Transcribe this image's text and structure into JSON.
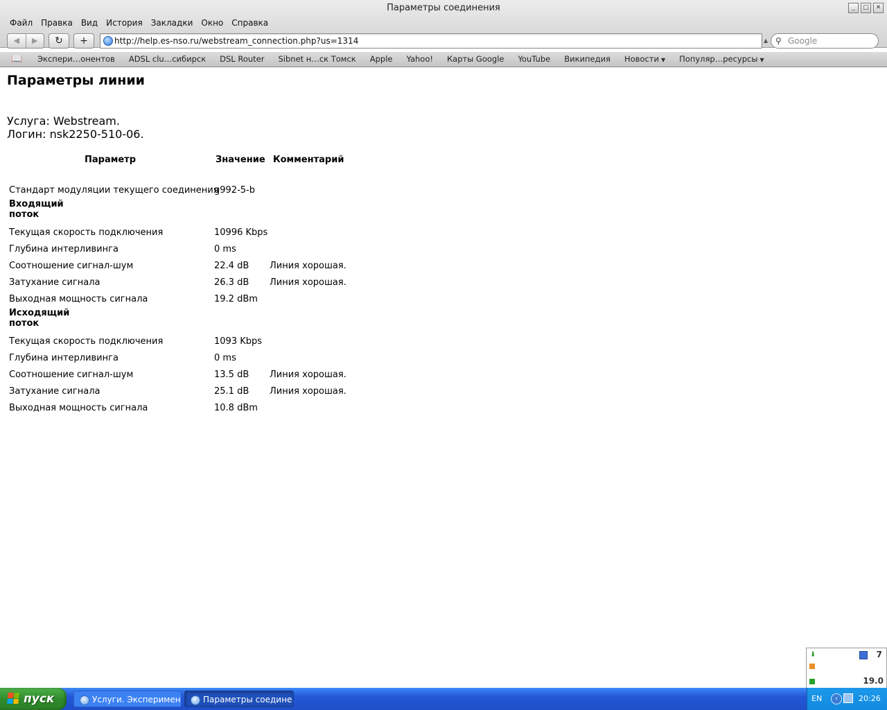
{
  "window": {
    "title": "Параметры соединения",
    "controls": {
      "minimize": "_",
      "maximize": "□",
      "close": "✕"
    }
  },
  "menu": [
    "Файл",
    "Правка",
    "Вид",
    "История",
    "Закладки",
    "Окно",
    "Справка"
  ],
  "toolbar": {
    "back": "◀",
    "forward": "▶",
    "reload": "↻",
    "add": "+",
    "url": "http://help.es-nso.ru/webstream_connection.php?us=1314",
    "search_placeholder": "Google"
  },
  "bookmarks": [
    {
      "label": "Экспери…онентов",
      "menu": false
    },
    {
      "label": "ADSL clu…сибирск",
      "menu": false
    },
    {
      "label": "DSL Router",
      "menu": false
    },
    {
      "label": "Sibnet н…ск Томск",
      "menu": false
    },
    {
      "label": "Apple",
      "menu": false
    },
    {
      "label": "Yahoo!",
      "menu": false
    },
    {
      "label": "Карты Google",
      "menu": false
    },
    {
      "label": "YouTube",
      "menu": false
    },
    {
      "label": "Википедия",
      "menu": false
    },
    {
      "label": "Новости",
      "menu": true
    },
    {
      "label": "Популяр…ресурсы",
      "menu": true
    }
  ],
  "page": {
    "title": "Параметры линии",
    "service": "Услуга: Webstream.",
    "login": "Логин: nsk2250-510-06.",
    "headers": {
      "param": "Параметр",
      "value": "Значение",
      "comment": "Комментарий"
    },
    "modulation": {
      "label": "Стандарт модуляции текущего соединения",
      "value": "g992-5-b"
    },
    "downstream": {
      "title": "Входящий поток",
      "rows": [
        {
          "label": "Текущая скорость подключения",
          "value": "10996 Kbps",
          "comment": ""
        },
        {
          "label": "Глубина интерливинга",
          "value": "0 ms",
          "comment": ""
        },
        {
          "label": "Соотношение сигнал-шум",
          "value": "22.4 dB",
          "comment": "Линия хорошая."
        },
        {
          "label": "Затухание сигнала",
          "value": "26.3 dB",
          "comment": "Линия хорошая."
        },
        {
          "label": "Выходная мощность сигнала",
          "value": "19.2 dBm",
          "comment": ""
        }
      ]
    },
    "upstream": {
      "title": "Исходящий поток",
      "rows": [
        {
          "label": "Текущая скорость подключения",
          "value": "1093 Kbps",
          "comment": ""
        },
        {
          "label": "Глубина интерливинга",
          "value": "0 ms",
          "comment": ""
        },
        {
          "label": "Соотношение сигнал-шум",
          "value": "13.5 dB",
          "comment": "Линия хорошая."
        },
        {
          "label": "Затухание сигнала",
          "value": "25.1 dB",
          "comment": "Линия хорошая."
        },
        {
          "label": "Выходная мощность сигнала",
          "value": "10.8 dBm",
          "comment": ""
        }
      ]
    }
  },
  "tray_widget": {
    "value_top": "7",
    "value_bottom": "19.0"
  },
  "taskbar": {
    "start_label": "пуск",
    "tasks": [
      "Услуги. Эксперимен…",
      "Параметры соедине…"
    ],
    "lang": "EN",
    "clock": "20:26"
  }
}
